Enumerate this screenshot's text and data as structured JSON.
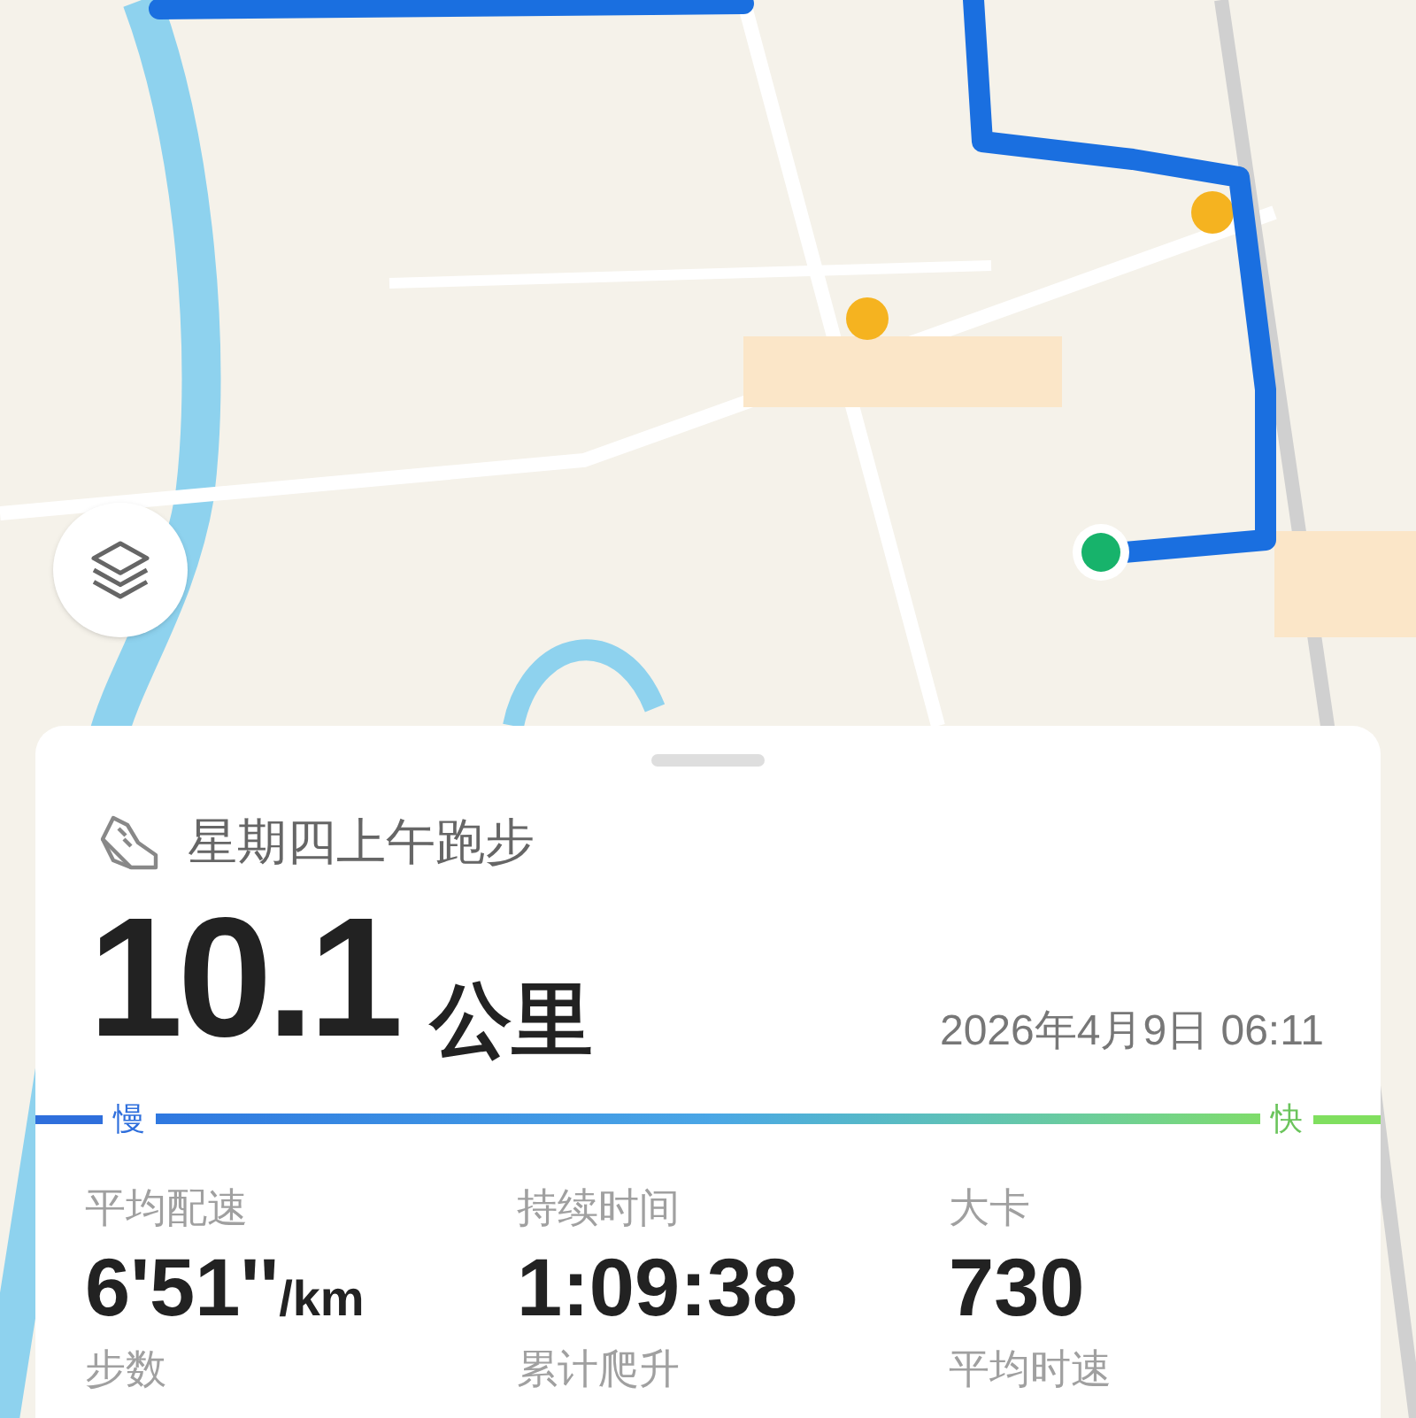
{
  "activity": {
    "title": "星期四上午跑步",
    "distance": "10.1",
    "unit": "公里",
    "datetime": "2026年4月9日 06:11"
  },
  "pace_scale": {
    "slow_label": "慢",
    "fast_label": "快"
  },
  "stats": [
    {
      "label": "平均配速",
      "value": "6'51''",
      "unit": "/km"
    },
    {
      "label": "持续时间",
      "value": "1:09:38"
    },
    {
      "label": "大卡",
      "value": "730"
    },
    {
      "label": "步数"
    },
    {
      "label": "累计爬升"
    },
    {
      "label": "平均时速"
    }
  ]
}
